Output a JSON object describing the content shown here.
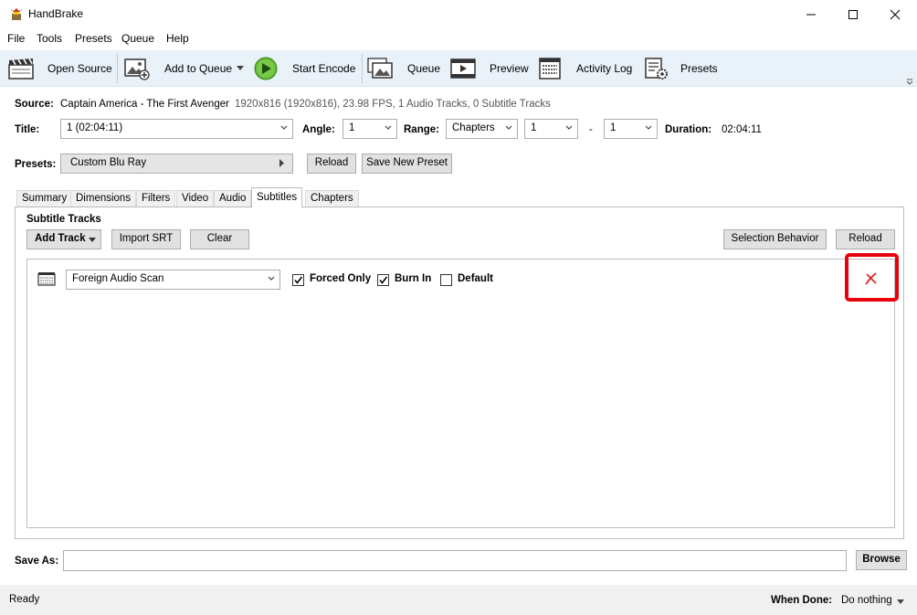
{
  "window": {
    "title": "HandBrake",
    "minimize_icon": "minimize-icon",
    "maximize_icon": "maximize-icon",
    "close_icon": "close-icon"
  },
  "menu": [
    "File",
    "Tools",
    "Presets",
    "Queue",
    "Help"
  ],
  "toolbar": {
    "open_source": "Open Source",
    "add_to_queue": "Add to Queue",
    "start_encode": "Start Encode",
    "queue": "Queue",
    "preview": "Preview",
    "activity_log": "Activity Log",
    "presets": "Presets"
  },
  "source": {
    "label": "Source:",
    "name": "Captain America - The First Avenger",
    "details": "1920x816 (1920x816), 23.98 FPS, 1 Audio Tracks, 0 Subtitle Tracks"
  },
  "title_row": {
    "title_label": "Title:",
    "title_value": "1 (02:04:11)",
    "angle_label": "Angle:",
    "angle_value": "1",
    "range_label": "Range:",
    "range_type": "Chapters",
    "range_start": "1",
    "range_dash": "-",
    "range_end": "1",
    "duration_label": "Duration:",
    "duration_value": "02:04:11"
  },
  "presets_row": {
    "label": "Presets:",
    "value": "Custom Blu Ray",
    "reload": "Reload",
    "save_new": "Save New Preset"
  },
  "tabs": [
    "Summary",
    "Dimensions",
    "Filters",
    "Video",
    "Audio",
    "Subtitles",
    "Chapters"
  ],
  "active_tab": "Subtitles",
  "subtitles": {
    "heading": "Subtitle Tracks",
    "add_track": "Add Track",
    "import_srt": "Import SRT",
    "clear": "Clear",
    "selection_behavior": "Selection Behavior",
    "reload": "Reload",
    "tracks": [
      {
        "source": "Foreign Audio Scan",
        "forced_only_label": "Forced Only",
        "forced_only": true,
        "burn_in_label": "Burn In",
        "burn_in": true,
        "default_label": "Default",
        "default": false
      }
    ]
  },
  "save_as": {
    "label": "Save As:",
    "value": "",
    "browse": "Browse"
  },
  "status": {
    "text": "Ready",
    "when_done_label": "When Done:",
    "when_done_value": "Do nothing"
  },
  "colors": {
    "toolbar_bg": "#e9f1f9",
    "highlight": "#e8000b",
    "remove_icon": "#d9262b"
  }
}
